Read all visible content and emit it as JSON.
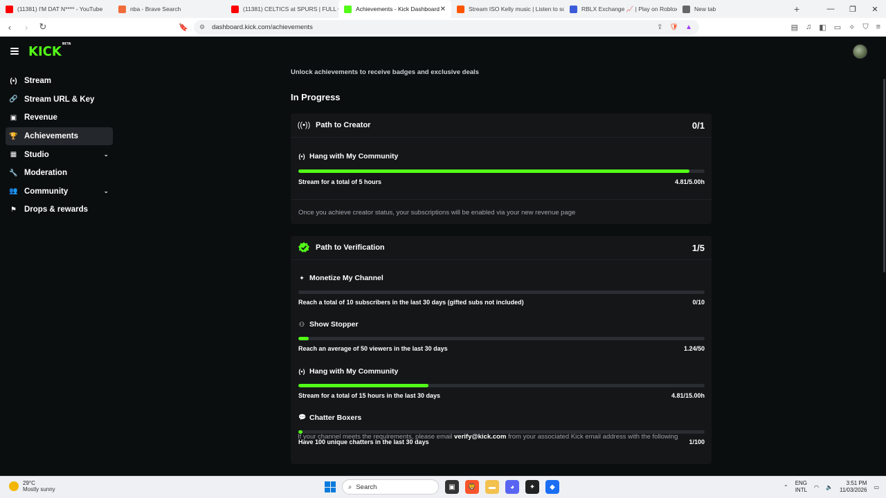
{
  "browser": {
    "tabs": [
      {
        "title": "(11381) I'M DAT N**** - YouTube",
        "color": "#ff0000"
      },
      {
        "title": "nba - Brave Search",
        "color": "#f26b3a"
      },
      {
        "title": "(11381) CELTICS at SPURS | FULL GA",
        "color": "#ff0000"
      },
      {
        "title": "Achievements - Kick Dashboard",
        "color": "#53fc18"
      },
      {
        "title": "Stream ISO Kelly music | Listen to so",
        "color": "#ff5500"
      },
      {
        "title": "RBLX Exchange 📈 | Play on Roblox",
        "color": "#3b5bdb"
      },
      {
        "title": "New tab",
        "color": "#666666"
      }
    ],
    "active_tab_index": 3,
    "url": "dashboard.kick.com/achievements"
  },
  "sidebar": {
    "items": [
      {
        "label": "Stream",
        "icon": "broadcast-icon",
        "glyph": "(•)"
      },
      {
        "label": "Stream URL & Key",
        "icon": "link-icon",
        "glyph": "🔗"
      },
      {
        "label": "Revenue",
        "icon": "chart-icon",
        "glyph": "▣"
      },
      {
        "label": "Achievements",
        "icon": "trophy-icon",
        "glyph": "🏆"
      },
      {
        "label": "Studio",
        "icon": "grid-icon",
        "glyph": "▦"
      },
      {
        "label": "Moderation",
        "icon": "wrench-icon",
        "glyph": "🔧"
      },
      {
        "label": "Community",
        "icon": "people-icon",
        "glyph": "👥"
      },
      {
        "label": "Drops & rewards",
        "icon": "gift-icon",
        "glyph": "⚑"
      }
    ],
    "active_index": 3
  },
  "main": {
    "subtitle": "Unlock achievements to receive badges and exclusive deals",
    "section_title": "In Progress",
    "creator": {
      "title": "Path to Creator",
      "count": "0/1",
      "goal_title": "Hang with My Community",
      "goal_desc": "Stream for a total of 5 hours",
      "goal_value": "4.81/5.00h",
      "progress": 0.962,
      "note": "Once you achieve creator status, your subscriptions will be enabled via your new revenue page"
    },
    "verification": {
      "title": "Path to Verification",
      "count": "1/5",
      "goals": [
        {
          "title": "Monetize My Channel",
          "desc": "Reach a total of 10 subscribers in the last 30 days (gifted subs not included)",
          "value": "0/10",
          "progress": 0.0
        },
        {
          "title": "Show Stopper",
          "desc": "Reach an average of 50 viewers in the last 30 days",
          "value": "1.24/50",
          "progress": 0.025
        },
        {
          "title": "Hang with My Community",
          "desc": "Stream for a total of 15 hours in the last 30 days",
          "value": "4.81/15.00h",
          "progress": 0.32
        },
        {
          "title": "Chatter Boxers",
          "desc": "Have 100 unique chatters in the last 30 days",
          "value": "1/100",
          "progress": 0.01
        }
      ]
    },
    "bottom_note_pre": "If your channel meets the requirements, please email",
    "bottom_note_email": "verify@kick.com",
    "bottom_note_post": "from your associated Kick email address with the following"
  },
  "taskbar": {
    "weather_temp": "29°C",
    "weather_desc": "Mostly sunny",
    "search_label": "Search",
    "lang_1": "ENG",
    "lang_2": "INTL",
    "time": "3:51 PM",
    "date": "11/03/2026"
  },
  "colors": {
    "accent": "#53fc18",
    "bg": "#0b0e0f",
    "card": "#141618"
  }
}
